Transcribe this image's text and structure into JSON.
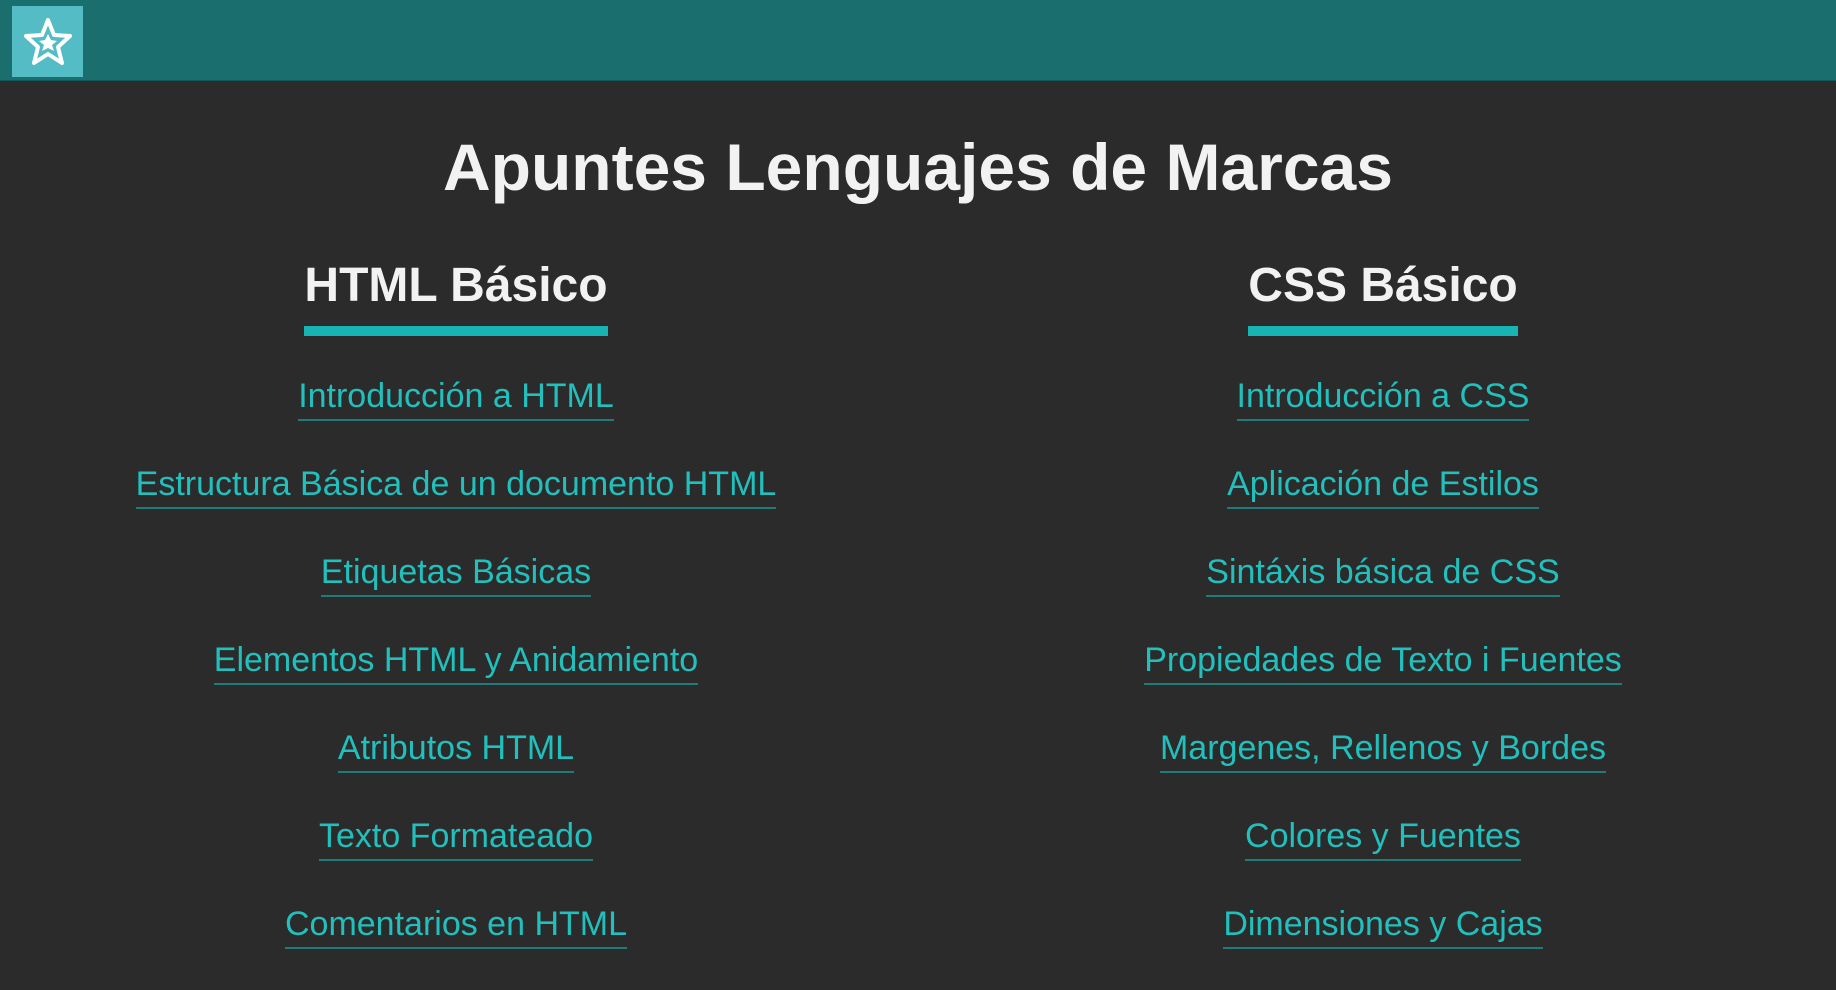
{
  "header": {
    "logo_icon": "star-icon",
    "accent_color": "#1b6e6e",
    "logo_bg_color": "#54bcc4"
  },
  "main": {
    "title": "Apuntes Lenguajes de Marcas",
    "sections": [
      {
        "heading": "HTML Básico",
        "links": [
          "Introducción a HTML",
          "Estructura Básica de un documento HTML",
          "Etiquetas Básicas",
          "Elementos HTML y Anidamiento",
          "Atributos HTML",
          "Texto Formateado",
          "Comentarios en HTML"
        ]
      },
      {
        "heading": "CSS Básico",
        "links": [
          "Introducción a CSS",
          "Aplicación de Estilos",
          "Sintáxis básica de CSS",
          "Propiedades de Texto i Fuentes",
          "Margenes, Rellenos y Bordes",
          "Colores y Fuentes",
          "Dimensiones y Cajas"
        ]
      }
    ]
  },
  "colors": {
    "background": "#2b2b2b",
    "heading_underline": "#17b4b4",
    "link": "#22c0bc",
    "text": "#f2f2f2"
  }
}
